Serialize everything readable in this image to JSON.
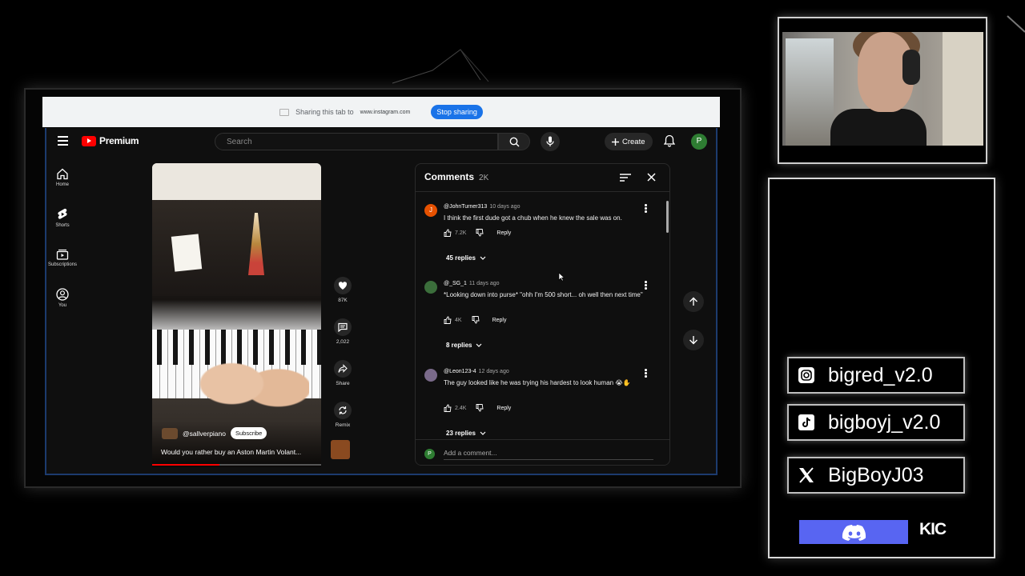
{
  "share_bar": {
    "sharing_text": "Sharing this tab to",
    "site": "www.instagram.com",
    "stop_label": "Stop sharing"
  },
  "youtube": {
    "brand": "Premium",
    "search_placeholder": "Search",
    "create_label": "Create",
    "avatar_letter": "P",
    "sidebar": [
      {
        "label": "Home",
        "icon": "home-icon"
      },
      {
        "label": "Shorts",
        "icon": "shorts-icon"
      },
      {
        "label": "Subscriptions",
        "icon": "subscriptions-icon"
      },
      {
        "label": "You",
        "icon": "you-icon"
      }
    ],
    "short": {
      "channel": "@sallverpiano",
      "subscribe_label": "Subscribe",
      "title": "Would you rather buy an Aston Martin Volant...",
      "likes": "87K",
      "comments_count": "2,022",
      "share_label": "Share",
      "remix_label": "Remix",
      "progress": 0.4
    },
    "comments_panel": {
      "title": "Comments",
      "count": "2K",
      "add_placeholder": "Add a comment...",
      "add_avatar": "P",
      "items": [
        {
          "author": "@JohnTurner313",
          "time": "10 days ago",
          "text": "I think the first dude got a chub when he knew the sale was on.",
          "likes": "7.2K",
          "reply_label": "Reply",
          "replies": "45 replies",
          "avatar_letter": "J",
          "avatar_color": "#e65100"
        },
        {
          "author": "@_SG_1",
          "time": "11 days ago",
          "text": "*Looking down into purse* \"ohh I'm 500 short... oh well then next time\"",
          "likes": "4K",
          "reply_label": "Reply",
          "replies": "8 replies",
          "avatar_letter": "",
          "avatar_color": "#3b6e3b"
        },
        {
          "author": "@Leon123-4",
          "time": "12 days ago",
          "text": "The guy looked like he was trying his hardest to look human 😭✋",
          "likes": "2.4K",
          "reply_label": "Reply",
          "replies": "23 replies",
          "avatar_letter": "",
          "avatar_color": "#7a6a8a"
        }
      ]
    }
  },
  "stream_overlay": {
    "socials": [
      {
        "platform": "instagram",
        "icon": "instagram-icon",
        "handle": "bigred_v2.0"
      },
      {
        "platform": "tiktok",
        "icon": "tiktok-icon",
        "handle": "bigboyj_v2.0"
      },
      {
        "platform": "x",
        "icon": "x-icon",
        "handle": "BigBoyJ03"
      }
    ],
    "kick_label": "KIC",
    "discord_color": "#5865f2"
  }
}
